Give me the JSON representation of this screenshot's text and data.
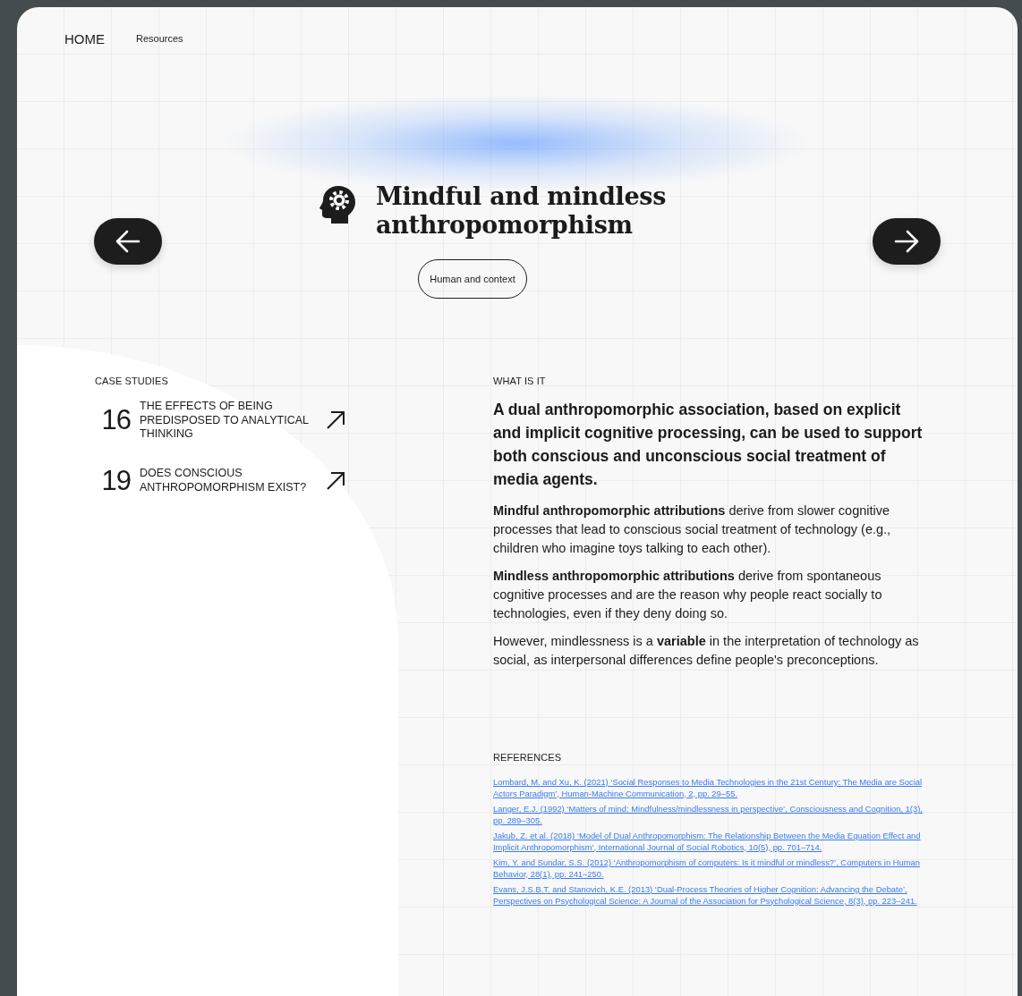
{
  "nav": [
    {
      "label": "HOME",
      "selected": true
    },
    {
      "label": "Resources",
      "selected": false
    }
  ],
  "hero": {
    "title": "Mindful and mindless anthropomorphism",
    "tag": "Human and context"
  },
  "case_studies": {
    "heading": "CASE STUDIES",
    "items": [
      {
        "number": "16",
        "title": "THE EFFECTS OF BEING PREDISPOSED TO ANALYTICAL THINKING"
      },
      {
        "number": "19",
        "title": "DOES CONSCIOUS ANTHROPOMORPHISM EXIST?"
      }
    ]
  },
  "what_is_it": {
    "heading": "WHAT IS IT",
    "lead": "A dual anthropomorphic association, based on explicit and implicit cognitive processing, can be used to support both conscious and unconscious social treatment of media agents.",
    "paragraphs": [
      "**Mindful anthropomorphic attributions** derive from slower cognitive processes that lead to conscious social treatment of technology (e.g., children who imagine toys talking to each other).",
      "**Mindless anthropomorphic attributions** derive from spontaneous cognitive processes and are the reason why people react socially to technologies, even if they deny doing so.",
      "However, mindlessness is a **variable** in the interpretation of technology as social, as interpersonal differences define people's preconceptions."
    ]
  },
  "references": {
    "heading": "REFERENCES",
    "items": [
      "Lombard, M. and Xu, K. (2021) ‘Social Responses to Media Technologies in the 21st Century: The Media are Social Actors Paradigm’, Human-Machine Communication, 2, pp. 29–55.",
      "Langer, E.J. (1992) ‘Matters of mind: Mindfulness/mindlessness in perspective’, Consciousness and Cognition, 1(3), pp. 289–305.",
      "Jakub, Z. et al. (2018) ‘Model of Dual Anthropomorphism: The Relationship Between the Media Equation Effect and Implicit Anthropomorphism’, International Journal of Social Robotics, 10(5), pp. 701–714.",
      "Kim, Y. and Sundar, S.S. (2012) ‘Anthropomorphism of computers: Is it mindful or mindless?’, Computers in Human Behavior, 28(1), pp. 241–250.",
      "Evans, J.S.B.T. and Stanovich, K.E. (2013) ‘Dual-Process Theories of Higher Cognition: Advancing the Debate’, Perspectives on Psychological Science: A Journal of the Association for Psychological Science, 8(3), pp. 223–241."
    ]
  }
}
